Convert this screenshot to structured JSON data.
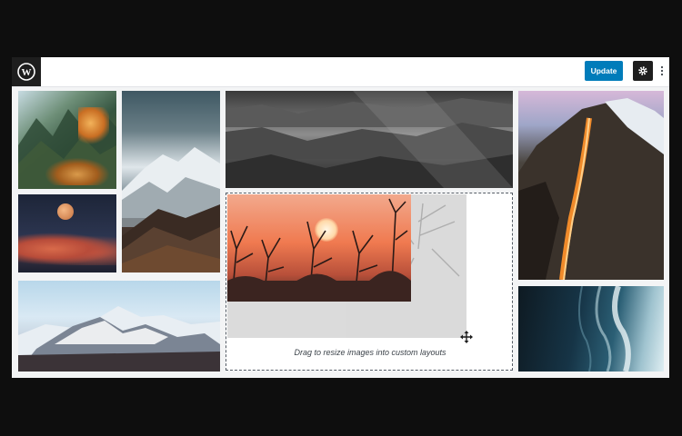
{
  "toolbar": {
    "logo_icon": "wordpress-logo-icon",
    "update_label": "Update",
    "settings_icon": "gear-icon",
    "more_icon": "vertical-ellipsis-icon",
    "accent_color": "#007cba"
  },
  "gallery": {
    "tiles": [
      {
        "subject": "autumn forest"
      },
      {
        "subject": "moon over clouds"
      },
      {
        "subject": "snowy mountains"
      },
      {
        "subject": "mountain and sand dunes"
      },
      {
        "subject": "canyon with light rays"
      },
      {
        "subject": "firefall on rock cliff"
      },
      {
        "subject": "ocean waves aerial"
      }
    ],
    "selected": {
      "subject": "sunset through branches",
      "resize_icon": "move-arrows-icon",
      "caption": "Drag to resize images into custom layouts"
    }
  }
}
